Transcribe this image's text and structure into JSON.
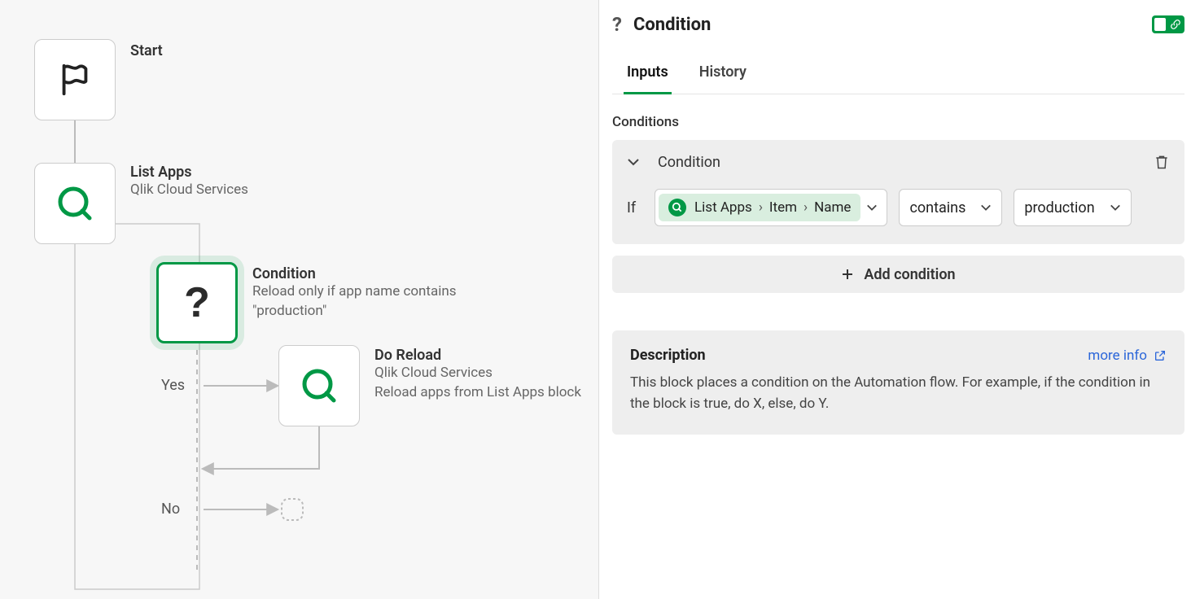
{
  "flow": {
    "start": {
      "title": "Start"
    },
    "listApps": {
      "title": "List Apps",
      "sub": "Qlik Cloud Services"
    },
    "condition": {
      "title": "Condition",
      "sub": "Reload only if app name contains \"production\""
    },
    "doReload": {
      "title": "Do Reload",
      "sub": "Qlik Cloud Services",
      "sub2": "Reload apps from List Apps block"
    },
    "yesLabel": "Yes",
    "noLabel": "No"
  },
  "panel": {
    "title": "Condition",
    "tabs": {
      "inputs": "Inputs",
      "history": "History"
    },
    "conditionsLabel": "Conditions",
    "conditionItem": {
      "header": "Condition",
      "ifLabel": "If",
      "path": [
        "List Apps",
        "Item",
        "Name"
      ],
      "operator": "contains",
      "value": "production"
    },
    "addCondition": "Add condition",
    "description": {
      "title": "Description",
      "text": "This block places a condition on the Automation flow. For example, if the condition in the block is true, do X, else, do Y.",
      "moreInfo": "more info"
    }
  }
}
